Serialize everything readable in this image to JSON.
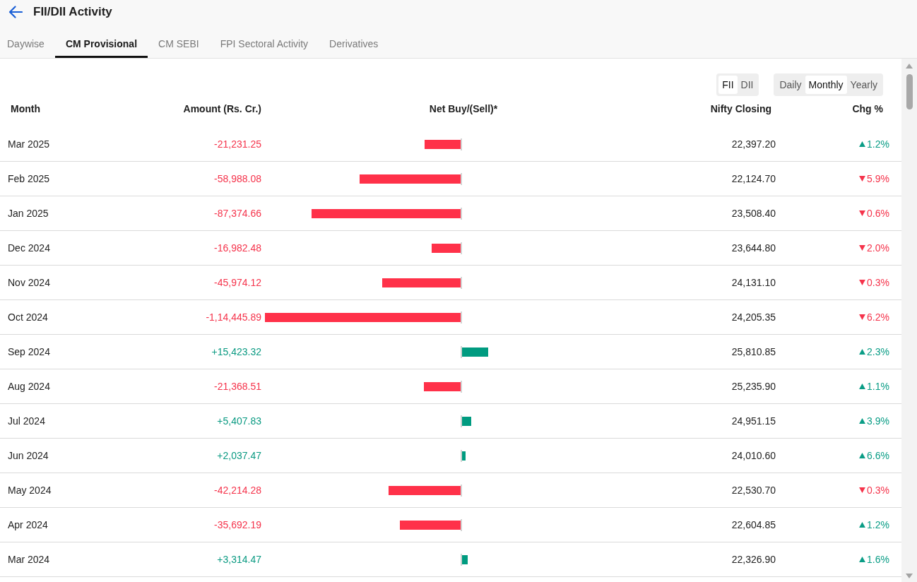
{
  "header": {
    "title": "FII/DII Activity"
  },
  "tabs": [
    {
      "label": "Daywise",
      "selected": false
    },
    {
      "label": "CM Provisional",
      "selected": true
    },
    {
      "label": "CM SEBI",
      "selected": false
    },
    {
      "label": "FPI Sectoral Activity",
      "selected": false
    },
    {
      "label": "Derivatives",
      "selected": false
    }
  ],
  "investor_toggle": [
    {
      "label": "FII",
      "selected": true
    },
    {
      "label": "DII",
      "selected": false
    }
  ],
  "period_toggle": [
    {
      "label": "Daily",
      "selected": false
    },
    {
      "label": "Monthly",
      "selected": true
    },
    {
      "label": "Yearly",
      "selected": false
    }
  ],
  "table": {
    "columns": [
      "Month",
      "Amount (Rs. Cr.)",
      "Net Buy/(Sell)*",
      "Nifty Closing",
      "Chg %"
    ],
    "rows": [
      {
        "month": "Mar 2025",
        "amount": "-21,231.25",
        "net_sell": true,
        "nifty_closing": "22,397.20",
        "change": "1.2%",
        "rising": true
      },
      {
        "month": "Feb 2025",
        "amount": "-58,988.08",
        "net_sell": true,
        "nifty_closing": "22,124.70",
        "change": "5.9%",
        "rising": false
      },
      {
        "month": "Jan 2025",
        "amount": "-87,374.66",
        "net_sell": true,
        "nifty_closing": "23,508.40",
        "change": "0.6%",
        "rising": false
      },
      {
        "month": "Dec 2024",
        "amount": "-16,982.48",
        "net_sell": true,
        "nifty_closing": "23,644.80",
        "change": "2.0%",
        "rising": false
      },
      {
        "month": "Nov 2024",
        "amount": "-45,974.12",
        "net_sell": true,
        "nifty_closing": "24,131.10",
        "change": "0.3%",
        "rising": false
      },
      {
        "month": "Oct 2024",
        "amount": "-1,14,445.89",
        "net_sell": true,
        "nifty_closing": "24,205.35",
        "change": "6.2%",
        "rising": false
      },
      {
        "month": "Sep 2024",
        "amount": "+15,423.32",
        "net_sell": false,
        "nifty_closing": "25,810.85",
        "change": "2.3%",
        "rising": true
      },
      {
        "month": "Aug 2024",
        "amount": "-21,368.51",
        "net_sell": true,
        "nifty_closing": "25,235.90",
        "change": "1.1%",
        "rising": true
      },
      {
        "month": "Jul 2024",
        "amount": "+5,407.83",
        "net_sell": false,
        "nifty_closing": "24,951.15",
        "change": "3.9%",
        "rising": true
      },
      {
        "month": "Jun 2024",
        "amount": "+2,037.47",
        "net_sell": false,
        "nifty_closing": "24,010.60",
        "change": "6.6%",
        "rising": true
      },
      {
        "month": "May 2024",
        "amount": "-42,214.28",
        "net_sell": true,
        "nifty_closing": "22,530.70",
        "change": "0.3%",
        "rising": false
      },
      {
        "month": "Apr 2024",
        "amount": "-35,692.19",
        "net_sell": true,
        "nifty_closing": "22,604.85",
        "change": "1.2%",
        "rising": true
      },
      {
        "month": "Mar 2024",
        "amount": "+3,314.47",
        "net_sell": false,
        "nifty_closing": "22,326.90",
        "change": "1.6%",
        "rising": true
      }
    ]
  }
}
